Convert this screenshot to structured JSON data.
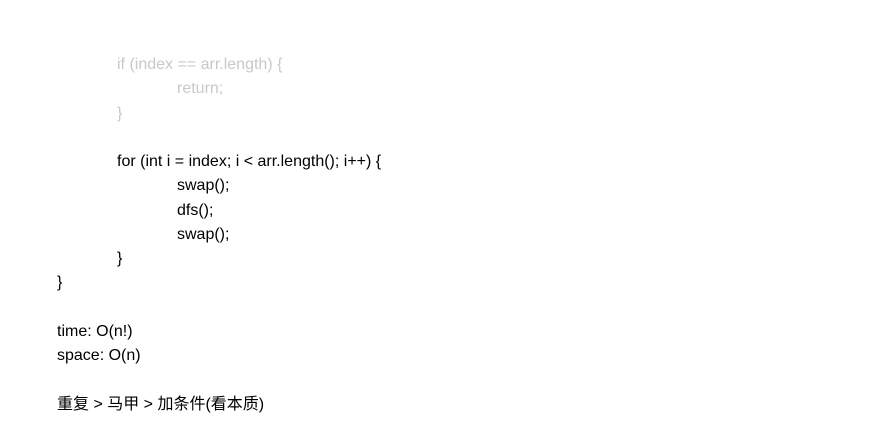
{
  "code": {
    "if_line": "if (index == arr.length) {",
    "return_line": "return;",
    "if_close": "}",
    "for_line": "for (int i = index; i < arr.length(); i++) {",
    "swap1": "swap();",
    "dfs": "dfs();",
    "swap2": "swap();",
    "for_close": "}",
    "func_close": "}"
  },
  "complexity": {
    "time": "time: O(n!)",
    "space": "space: O(n)"
  },
  "note": "重复 > 马甲 > 加条件(看本质)",
  "colors": {
    "faded_text": "#c8c8c8",
    "text": "#000000",
    "background": "#ffffff"
  }
}
